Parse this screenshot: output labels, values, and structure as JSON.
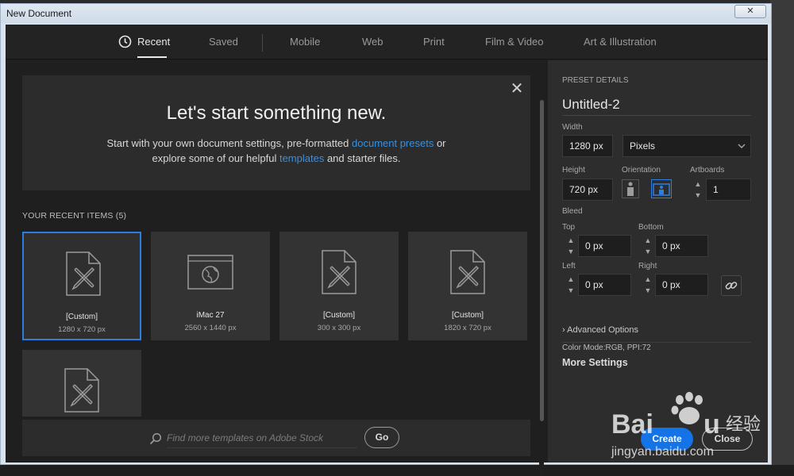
{
  "window": {
    "title": "New Document",
    "close_glyph": "✕"
  },
  "tabs": [
    {
      "label": "Recent",
      "active": true
    },
    {
      "label": "Saved"
    },
    {
      "label": "Mobile"
    },
    {
      "label": "Web"
    },
    {
      "label": "Print"
    },
    {
      "label": "Film & Video"
    },
    {
      "label": "Art & Illustration"
    }
  ],
  "hero": {
    "title": "Let's start something new.",
    "line1_a": "Start with your own document settings, pre-formatted ",
    "line1_link": "document presets",
    "line1_b": " or",
    "line2_a": "explore some of our helpful ",
    "line2_link": "templates",
    "line2_b": " and starter files.",
    "close_glyph": "✕"
  },
  "recent": {
    "heading": "YOUR RECENT ITEMS",
    "count": "(5)",
    "items": [
      {
        "name": "[Custom]",
        "size": "1280 x 720 px",
        "icon": "document-pencil-icon"
      },
      {
        "name": "iMac 27",
        "size": "2560 x 1440 px",
        "icon": "browser-globe-icon"
      },
      {
        "name": "[Custom]",
        "size": "300 x 300 px",
        "icon": "document-pencil-icon"
      },
      {
        "name": "[Custom]",
        "size": "1820 x 720 px",
        "icon": "document-pencil-icon"
      },
      {
        "name": "",
        "size": "",
        "icon": "document-pencil-icon"
      }
    ]
  },
  "search": {
    "placeholder": "Find more templates on Adobe Stock",
    "go_label": "Go"
  },
  "preset": {
    "heading": "PRESET DETAILS",
    "name": "Untitled-2",
    "width_label": "Width",
    "width_value": "1280 px",
    "units": "Pixels",
    "height_label": "Height",
    "height_value": "720 px",
    "orientation_label": "Orientation",
    "artboards_label": "Artboards",
    "artboards_value": "1",
    "bleed_label": "Bleed",
    "top_label": "Top",
    "top_value": "0 px",
    "bottom_label": "Bottom",
    "bottom_value": "0 px",
    "left_label": "Left",
    "left_value": "0 px",
    "right_label": "Right",
    "right_value": "0 px",
    "advanced_label": "Advanced Options",
    "color_mode": "Color Mode:RGB, PPI:72",
    "more_settings": "More Settings",
    "create_label": "Create",
    "close_label": "Close"
  },
  "watermark": {
    "text": "Baidu 经验",
    "url": "jingyan.baidu.com"
  },
  "colors": {
    "accent": "#1473e6",
    "link": "#3a8fdc"
  }
}
